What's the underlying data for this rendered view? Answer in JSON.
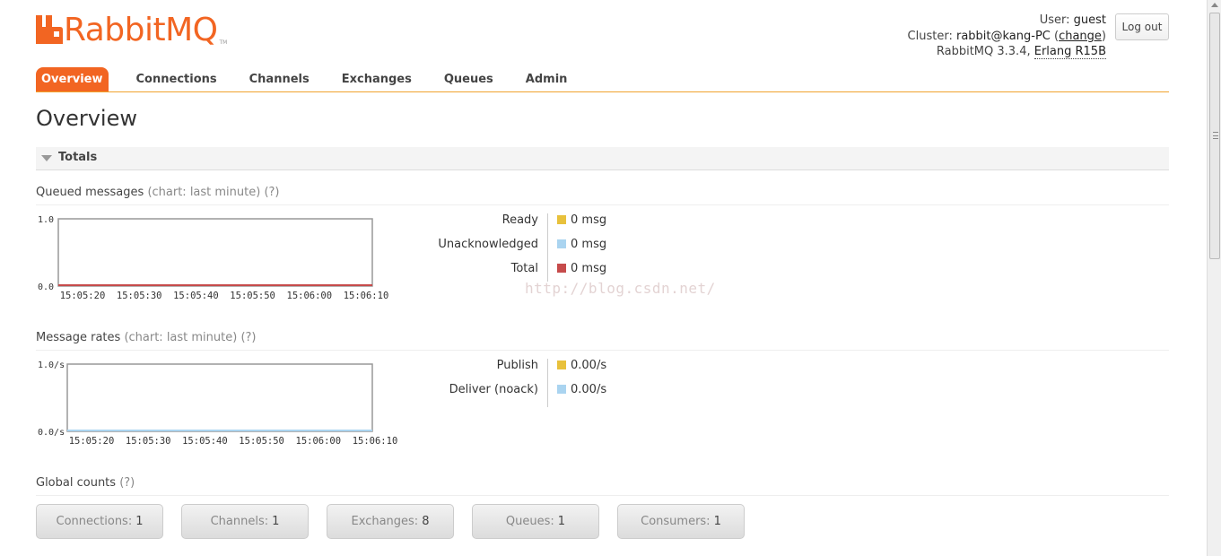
{
  "app": {
    "logo_text": "RabbitMQ",
    "logo_tm": "TM",
    "brand_color": "#f26522"
  },
  "header": {
    "user_label": "User:",
    "user_name": "guest",
    "cluster_label": "Cluster:",
    "cluster_name": "rabbit@kang-PC",
    "change_link": "change",
    "version_text": "RabbitMQ 3.3.4,",
    "erlang_text": "Erlang R15B",
    "logout_label": "Log out"
  },
  "nav": {
    "tabs": [
      {
        "label": "Overview",
        "active": true
      },
      {
        "label": "Connections"
      },
      {
        "label": "Channels"
      },
      {
        "label": "Exchanges"
      },
      {
        "label": "Queues"
      },
      {
        "label": "Admin"
      }
    ]
  },
  "page": {
    "title": "Overview"
  },
  "totals": {
    "label": "Totals"
  },
  "queued": {
    "title": "Queued messages",
    "hint": "(chart: last minute) (?)",
    "legend": [
      {
        "label": "Ready",
        "value": "0 msg",
        "color": "#e8c13c"
      },
      {
        "label": "Unacknowledged",
        "value": "0 msg",
        "color": "#aad4f0"
      },
      {
        "label": "Total",
        "value": "0 msg",
        "color": "#c64b4b"
      }
    ]
  },
  "rates": {
    "title": "Message rates",
    "hint": "(chart: last minute) (?)",
    "legend": [
      {
        "label": "Publish",
        "value": "0.00/s",
        "color": "#e8c13c"
      },
      {
        "label": "Deliver (noack)",
        "value": "0.00/s",
        "color": "#aad4f0"
      }
    ]
  },
  "chart_data": [
    {
      "type": "line",
      "x": [
        "15:05:20",
        "15:05:30",
        "15:05:40",
        "15:05:50",
        "15:06:00",
        "15:06:10"
      ],
      "ylim": [
        0.0,
        1.0
      ],
      "yticks": [
        "0.0",
        "1.0"
      ],
      "series": [
        {
          "name": "Ready",
          "values": [
            0,
            0,
            0,
            0,
            0,
            0
          ],
          "color": "#e8c13c"
        },
        {
          "name": "Unacknowledged",
          "values": [
            0,
            0,
            0,
            0,
            0,
            0
          ],
          "color": "#aad4f0"
        },
        {
          "name": "Total",
          "values": [
            0,
            0,
            0,
            0,
            0,
            0
          ],
          "color": "#c64b4b"
        }
      ]
    },
    {
      "type": "line",
      "x": [
        "15:05:20",
        "15:05:30",
        "15:05:40",
        "15:05:50",
        "15:06:00",
        "15:06:10"
      ],
      "ylim": [
        0.0,
        1.0
      ],
      "yticks": [
        "0.0/s",
        "1.0/s"
      ],
      "series": [
        {
          "name": "Publish",
          "values": [
            0,
            0,
            0,
            0,
            0,
            0
          ],
          "color": "#e8c13c"
        },
        {
          "name": "Deliver (noack)",
          "values": [
            0,
            0,
            0,
            0,
            0,
            0
          ],
          "color": "#aad4f0"
        }
      ]
    }
  ],
  "global_counts": {
    "title": "Global counts",
    "hint": "(?)",
    "items": [
      {
        "label": "Connections:",
        "value": "1"
      },
      {
        "label": "Channels:",
        "value": "1"
      },
      {
        "label": "Exchanges:",
        "value": "8"
      },
      {
        "label": "Queues:",
        "value": "1"
      },
      {
        "label": "Consumers:",
        "value": "1"
      }
    ]
  },
  "watermark": "http://blog.csdn.net/"
}
